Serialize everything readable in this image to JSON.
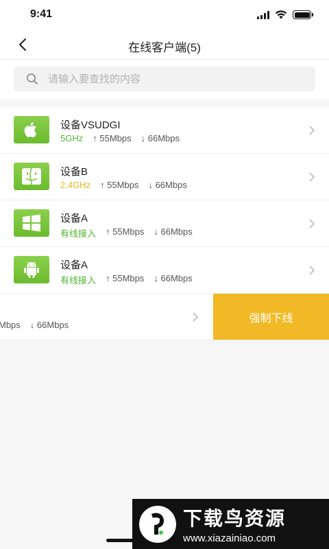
{
  "status_bar": {
    "time": "9:41"
  },
  "nav": {
    "title": "在线客户端(5)"
  },
  "search": {
    "placeholder": "请输入要查找的内容"
  },
  "devices": [
    {
      "name": "设备VSUDGI",
      "band": "5GHz",
      "band_color": "#52b435",
      "up": "55Mbps",
      "down": "66Mbps",
      "icon": "apple-icon"
    },
    {
      "name": "设备B",
      "band": "2.4GHz",
      "band_color": "#e7b51c",
      "up": "55Mbps",
      "down": "66Mbps",
      "icon": "finder-icon"
    },
    {
      "name": "设备A",
      "band": "有线接入",
      "band_color": "#52b435",
      "up": "55Mbps",
      "down": "66Mbps",
      "icon": "windows-icon"
    },
    {
      "name": "设备A",
      "band": "有线接入",
      "band_color": "#52b435",
      "up": "55Mbps",
      "down": "66Mbps",
      "icon": "android-icon"
    }
  ],
  "swiped_row": {
    "up_partial": "Mbps",
    "down": "66Mbps",
    "action_label": "强制下线"
  },
  "watermark": {
    "title": "下载鸟资源",
    "url": "www.xiazainiao.com"
  },
  "colors": {
    "accent_green": "#6cbb2e",
    "action_yellow": "#f0b925"
  }
}
